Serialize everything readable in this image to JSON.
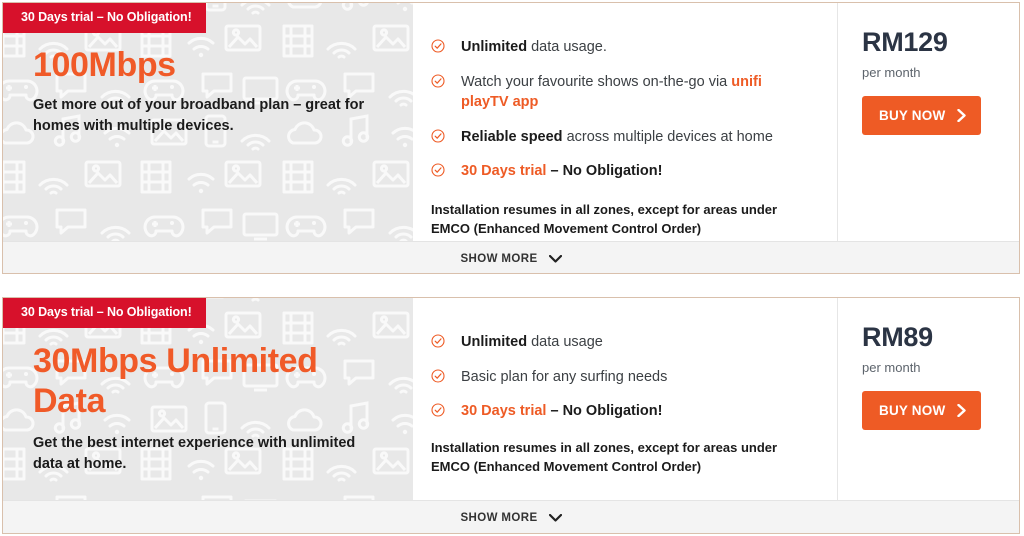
{
  "colors": {
    "badge_red": "#d7112b",
    "accent_orange": "#ee5b25",
    "title_orange": "#f05a28",
    "price_navy": "#2b3444",
    "card_border": "#d9c0ac",
    "promo_bg": "#e8e8e8",
    "footer_bg": "#f4f4f4"
  },
  "cards": [
    {
      "badge": "30 Days trial – No Obligation!",
      "title": "100Mbps",
      "description": "Get more out of your broadband plan – great for homes with multiple devices.",
      "features": [
        {
          "icon": "check-circle-icon",
          "segments": [
            {
              "text": "Unlimited",
              "style": "bold"
            },
            {
              "text": " data usage.",
              "style": "normal"
            }
          ]
        },
        {
          "icon": "check-circle-icon",
          "segments": [
            {
              "text": "Watch your favourite shows on-the-go via ",
              "style": "normal"
            },
            {
              "text": "unifi playTV app",
              "style": "accent"
            }
          ]
        },
        {
          "icon": "check-circle-icon",
          "segments": [
            {
              "text": "Reliable speed",
              "style": "bold"
            },
            {
              "text": " across multiple devices at home",
              "style": "normal"
            }
          ]
        },
        {
          "icon": "check-circle-icon",
          "segments": [
            {
              "text": "30 Days trial",
              "style": "accent"
            },
            {
              "text": " – No Obligation!",
              "style": "dark-bold"
            }
          ]
        }
      ],
      "install_note": "Installation resumes in all zones, except for areas under EMCO (Enhanced Movement Control Order)",
      "price": "RM129",
      "price_period": "per month",
      "buy_label": "BUY NOW",
      "show_more_label": "SHOW MORE"
    },
    {
      "badge": "30 Days trial – No Obligation!",
      "title": "30Mbps Unlimited Data",
      "description": "Get the best internet experience with unlimited data at home.",
      "features": [
        {
          "icon": "check-circle-icon",
          "segments": [
            {
              "text": "Unlimited",
              "style": "bold"
            },
            {
              "text": " data usage",
              "style": "normal"
            }
          ]
        },
        {
          "icon": "check-circle-icon",
          "segments": [
            {
              "text": "Basic plan for any surfing needs",
              "style": "normal"
            }
          ]
        },
        {
          "icon": "check-circle-icon",
          "segments": [
            {
              "text": "30 Days trial",
              "style": "accent"
            },
            {
              "text": " – No Obligation!",
              "style": "dark-bold"
            }
          ]
        }
      ],
      "install_note": "Installation resumes in all zones, except for areas under EMCO (Enhanced Movement Control Order)",
      "price": "RM89",
      "price_period": "per month",
      "buy_label": "BUY NOW",
      "show_more_label": "SHOW MORE"
    }
  ]
}
